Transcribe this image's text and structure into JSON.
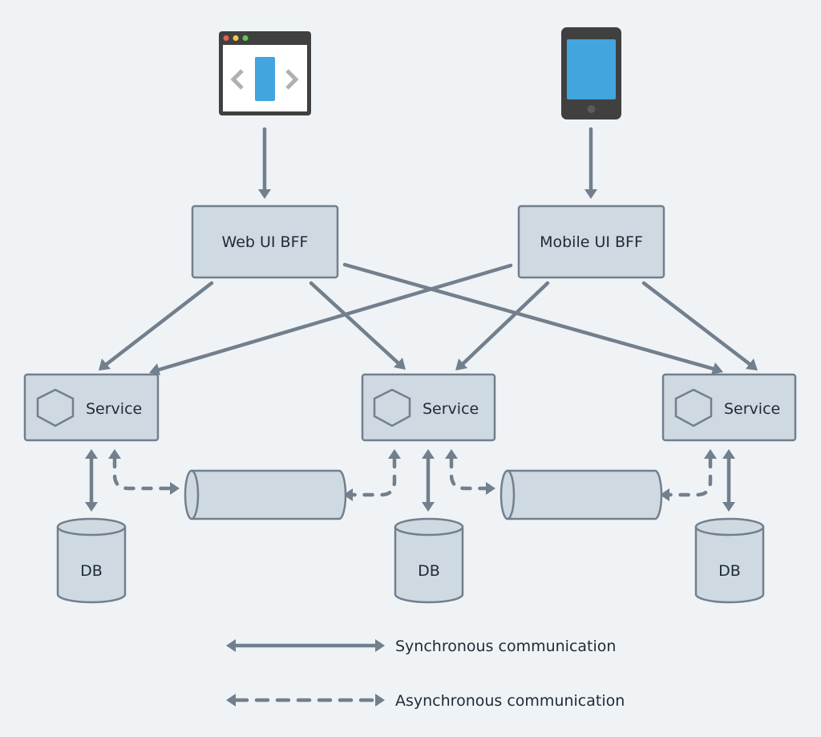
{
  "clients": {
    "web": {
      "icon": "browser-window-icon"
    },
    "mobile": {
      "icon": "mobile-phone-icon"
    }
  },
  "bffs": [
    {
      "label": "Web UI BFF"
    },
    {
      "label": "Mobile UI BFF"
    }
  ],
  "services": [
    {
      "label": "Service",
      "icon": "hexagon-icon"
    },
    {
      "label": "Service",
      "icon": "hexagon-icon"
    },
    {
      "label": "Service",
      "icon": "hexagon-icon"
    }
  ],
  "databases": [
    {
      "label": "DB"
    },
    {
      "label": "DB"
    },
    {
      "label": "DB"
    }
  ],
  "queues": [
    {
      "icon": "message-queue-icon"
    },
    {
      "icon": "message-queue-icon"
    }
  ],
  "legend": {
    "sync": "Synchronous communication",
    "async": "Asynchronous communication"
  },
  "colors": {
    "background": "#eff3f6",
    "box_fill": "#cfd9e1",
    "stroke": "#727f8c",
    "text": "#1e2a36",
    "screen_blue": "#42a5de",
    "device_dark": "#404040"
  }
}
